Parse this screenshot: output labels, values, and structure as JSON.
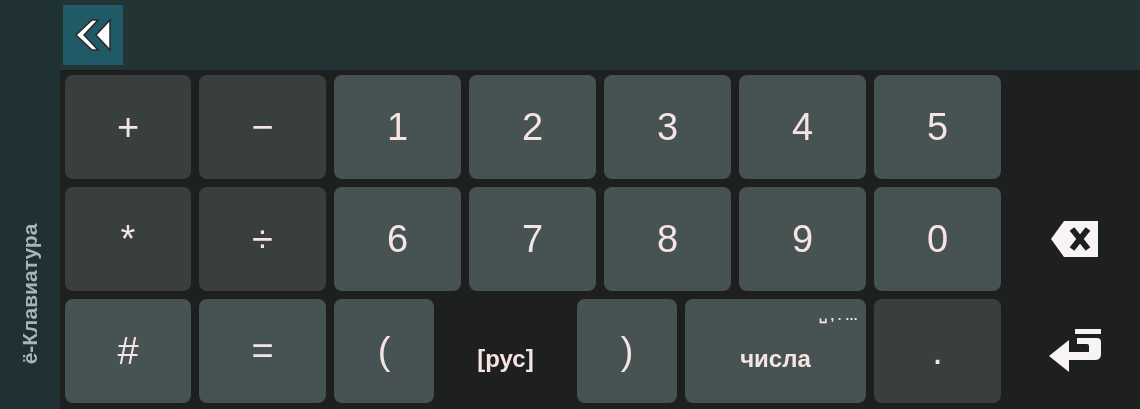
{
  "sidebar": {
    "title": "ё-Клавиатура"
  },
  "toolbar": {
    "back_button": {
      "kind": "collapse"
    }
  },
  "rows": [
    {
      "keys": [
        {
          "label": "+",
          "kind": "dark"
        },
        {
          "label": "−",
          "kind": "dark"
        },
        {
          "label": "1",
          "kind": "light"
        },
        {
          "label": "2",
          "kind": "light"
        },
        {
          "label": "3",
          "kind": "light"
        },
        {
          "label": "4",
          "kind": "light"
        },
        {
          "label": "5",
          "kind": "light"
        },
        {
          "kind": "blank"
        }
      ]
    },
    {
      "keys": [
        {
          "label": "*",
          "kind": "dark"
        },
        {
          "label": "÷",
          "kind": "dark"
        },
        {
          "label": "6",
          "kind": "light"
        },
        {
          "label": "7",
          "kind": "light"
        },
        {
          "label": "8",
          "kind": "light"
        },
        {
          "label": "9",
          "kind": "light"
        },
        {
          "label": "0",
          "kind": "light"
        },
        {
          "kind": "backspace"
        }
      ]
    },
    {
      "keys": [
        {
          "label": "#",
          "kind": "light"
        },
        {
          "label": "=",
          "kind": "light"
        },
        {
          "label": "(",
          "kind": "light"
        },
        {
          "label": "[рус]",
          "kind": "plain"
        },
        {
          "label": ")",
          "kind": "light"
        },
        {
          "label": "числа",
          "hint": "␣ , . …",
          "kind": "light"
        },
        {
          "label": ".",
          "kind": "dark"
        },
        {
          "kind": "enter"
        }
      ]
    }
  ]
}
